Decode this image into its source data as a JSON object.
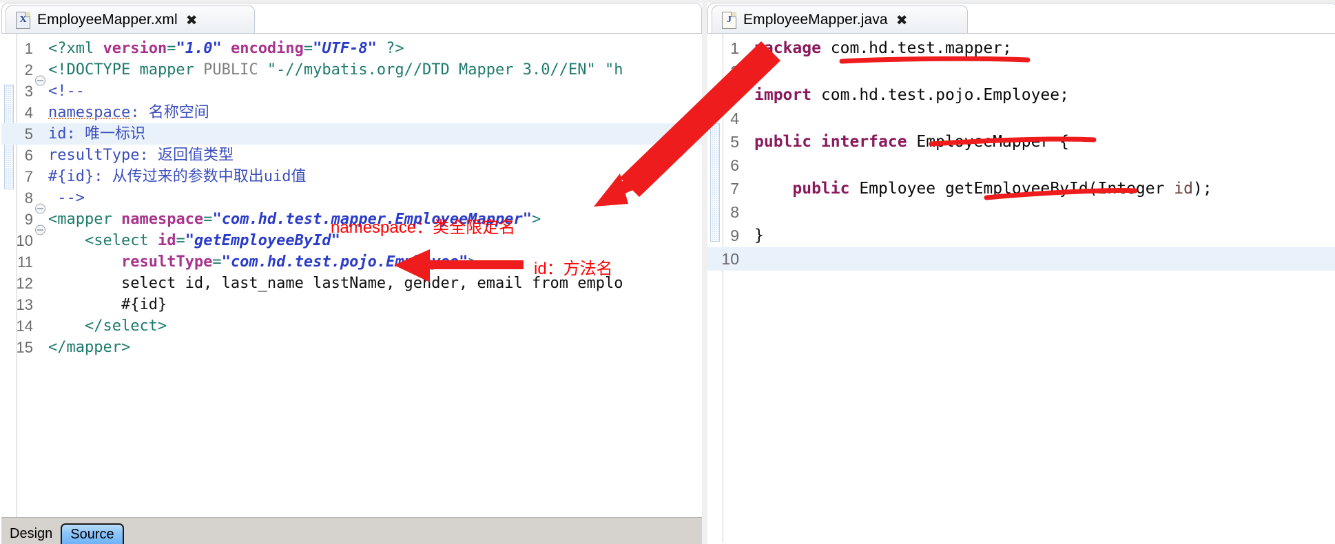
{
  "left_panel": {
    "tab": {
      "title": "EmployeeMapper.xml",
      "icon": "xml-file-icon",
      "icon_letter": "X",
      "close_glyph": "✖"
    },
    "bottom_tabs": [
      {
        "label": "Design",
        "active": false
      },
      {
        "label": "Source",
        "active": true
      }
    ],
    "lines": [
      {
        "num": "1",
        "fold": false,
        "highlight": false,
        "tokens": [
          {
            "text": "<?xml ",
            "cls": "t-tag"
          },
          {
            "text": "version",
            "cls": "t-attr"
          },
          {
            "text": "=",
            "cls": "t-punc"
          },
          {
            "text": "\"",
            "cls": "t-quote"
          },
          {
            "text": "1.0",
            "cls": "t-val"
          },
          {
            "text": "\"",
            "cls": "t-quote"
          },
          {
            "text": " ",
            "cls": "t-text"
          },
          {
            "text": "encoding",
            "cls": "t-attr"
          },
          {
            "text": "=",
            "cls": "t-punc"
          },
          {
            "text": "\"",
            "cls": "t-quote"
          },
          {
            "text": "UTF-8",
            "cls": "t-val"
          },
          {
            "text": "\"",
            "cls": "t-quote"
          },
          {
            "text": " ",
            "cls": "t-text"
          },
          {
            "text": "?>",
            "cls": "t-tag"
          }
        ]
      },
      {
        "num": "2",
        "fold": false,
        "highlight": false,
        "tokens": [
          {
            "text": "<!DOCTYPE mapper ",
            "cls": "t-doctype"
          },
          {
            "text": "PUBLIC ",
            "cls": "t-dtdstr"
          },
          {
            "text": "\"-//mybatis.org//DTD Mapper 3.0//EN\" \"",
            "cls": "t-doctype"
          },
          {
            "text": "h",
            "cls": "t-doctype"
          }
        ]
      },
      {
        "num": "3",
        "fold": true,
        "highlight": false,
        "tokens": [
          {
            "text": "<!--",
            "cls": "t-comment"
          }
        ]
      },
      {
        "num": "4",
        "fold": false,
        "highlight": false,
        "tokens": [
          {
            "text": "namespace",
            "cls": "t-comment spell"
          },
          {
            "text": ": 名称空间",
            "cls": "t-comment"
          }
        ]
      },
      {
        "num": "5",
        "fold": false,
        "highlight": true,
        "tokens": [
          {
            "text": "id: 唯一标识",
            "cls": "t-comment"
          }
        ]
      },
      {
        "num": "6",
        "fold": false,
        "highlight": false,
        "tokens": [
          {
            "text": "resultType: 返回值类型",
            "cls": "t-comment"
          }
        ]
      },
      {
        "num": "7",
        "fold": false,
        "highlight": false,
        "tokens": [
          {
            "text": "#{id}: 从传过来的参数中取出uid值",
            "cls": "t-comment"
          }
        ]
      },
      {
        "num": "8",
        "fold": false,
        "highlight": false,
        "tokens": [
          {
            "text": " -->",
            "cls": "t-comment"
          }
        ]
      },
      {
        "num": "9",
        "fold": true,
        "highlight": false,
        "tokens": [
          {
            "text": "<mapper ",
            "cls": "t-tag"
          },
          {
            "text": "namespace",
            "cls": "t-attr"
          },
          {
            "text": "=",
            "cls": "t-punc"
          },
          {
            "text": "\"",
            "cls": "t-quote"
          },
          {
            "text": "com.hd.test.mapper.EmployeeMapper",
            "cls": "t-val"
          },
          {
            "text": "\"",
            "cls": "t-quote"
          },
          {
            "text": ">",
            "cls": "t-tag"
          }
        ]
      },
      {
        "num": "10",
        "fold": true,
        "highlight": false,
        "tokens": [
          {
            "text": "    <select ",
            "cls": "t-tag"
          },
          {
            "text": "id",
            "cls": "t-attr"
          },
          {
            "text": "=",
            "cls": "t-punc"
          },
          {
            "text": "\"",
            "cls": "t-quote"
          },
          {
            "text": "getEmployeeById",
            "cls": "t-val"
          },
          {
            "text": "\"",
            "cls": "t-quote"
          }
        ]
      },
      {
        "num": "11",
        "fold": false,
        "highlight": false,
        "tokens": [
          {
            "text": "        ",
            "cls": "t-text"
          },
          {
            "text": "resultType",
            "cls": "t-attr"
          },
          {
            "text": "=",
            "cls": "t-punc"
          },
          {
            "text": "\"",
            "cls": "t-quote"
          },
          {
            "text": "com.hd.test.pojo.Employee",
            "cls": "t-val"
          },
          {
            "text": "\"",
            "cls": "t-quote"
          },
          {
            "text": ">",
            "cls": "t-tag"
          }
        ]
      },
      {
        "num": "12",
        "fold": false,
        "highlight": false,
        "tokens": [
          {
            "text": "        select id, last_name lastName, gender, email from emplo",
            "cls": "t-text"
          }
        ]
      },
      {
        "num": "13",
        "fold": false,
        "highlight": false,
        "tokens": [
          {
            "text": "        #{id}",
            "cls": "t-text"
          }
        ]
      },
      {
        "num": "14",
        "fold": false,
        "highlight": false,
        "tokens": [
          {
            "text": "    </select>",
            "cls": "t-tag"
          }
        ]
      },
      {
        "num": "15",
        "fold": false,
        "highlight": false,
        "tokens": [
          {
            "text": "</mapper>",
            "cls": "t-tag"
          }
        ]
      }
    ]
  },
  "right_panel": {
    "tab": {
      "title": "EmployeeMapper.java",
      "icon": "java-file-icon",
      "icon_letter": "J",
      "close_glyph": "✖"
    },
    "lines": [
      {
        "num": "1",
        "highlight": false,
        "tokens": [
          {
            "text": "package",
            "cls": "j-kw"
          },
          {
            "text": " com.hd.test.mapper;",
            "cls": "j-plain"
          }
        ]
      },
      {
        "num": "2",
        "highlight": false,
        "tokens": []
      },
      {
        "num": "3",
        "highlight": false,
        "tokens": [
          {
            "text": "import",
            "cls": "j-kw"
          },
          {
            "text": " com.hd.test.pojo.Employee;",
            "cls": "j-plain"
          }
        ]
      },
      {
        "num": "4",
        "highlight": false,
        "tokens": []
      },
      {
        "num": "5",
        "highlight": false,
        "tokens": [
          {
            "text": "public interface",
            "cls": "j-kw"
          },
          {
            "text": " EmployeeMapper {",
            "cls": "j-plain"
          }
        ]
      },
      {
        "num": "6",
        "highlight": false,
        "tokens": []
      },
      {
        "num": "7",
        "highlight": false,
        "tokens": [
          {
            "text": "    ",
            "cls": "j-plain"
          },
          {
            "text": "public",
            "cls": "j-kw"
          },
          {
            "text": " Employee getEmployeeById(Integer ",
            "cls": "j-plain"
          },
          {
            "text": "id",
            "cls": "j-param"
          },
          {
            "text": ");",
            "cls": "j-plain"
          }
        ]
      },
      {
        "num": "8",
        "highlight": false,
        "tokens": []
      },
      {
        "num": "9",
        "highlight": false,
        "tokens": [
          {
            "text": "}",
            "cls": "j-plain"
          }
        ]
      },
      {
        "num": "10",
        "highlight": true,
        "tokens": []
      }
    ]
  },
  "annotations": {
    "namespace_note": "namespace：类全限定名",
    "id_note": "id：方法名",
    "color": "#ff0000",
    "shapes": [
      "big-diagonal-arrow",
      "left-pointing-arrow",
      "underline-package",
      "underline-interface-name",
      "underline-method-name"
    ]
  }
}
